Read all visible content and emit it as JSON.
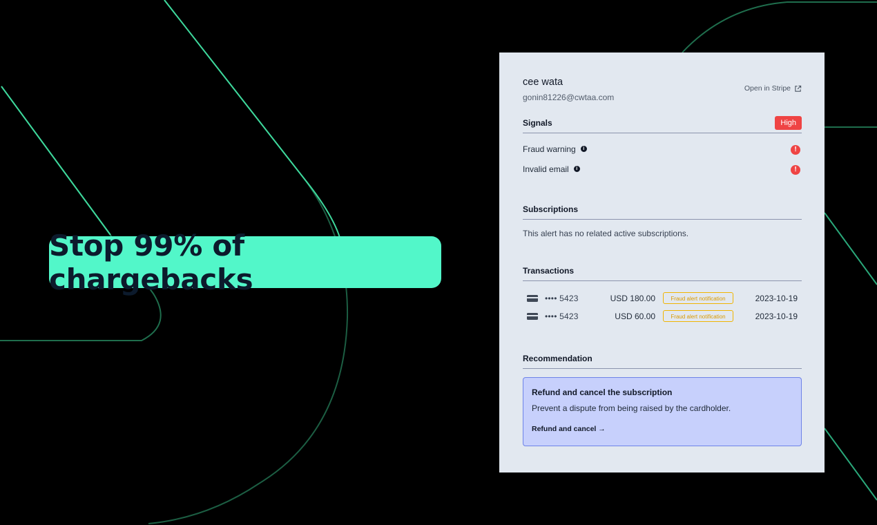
{
  "headline": "Stop 99% of chargebacks",
  "customer": {
    "name": "cee wata",
    "email": "gonin81226@cwtaa.com",
    "open_link": "Open in Stripe"
  },
  "signals": {
    "title": "Signals",
    "risk_badge": "High",
    "items": [
      {
        "label": "Fraud warning"
      },
      {
        "label": "Invalid email"
      }
    ]
  },
  "subscriptions": {
    "title": "Subscriptions",
    "empty_text": "This alert has no related active subscriptions."
  },
  "transactions": {
    "title": "Transactions",
    "rows": [
      {
        "card": "•••• 5423",
        "amount": "USD 180.00",
        "tag": "Fraud alert notification",
        "date": "2023-10-19"
      },
      {
        "card": "•••• 5423",
        "amount": "USD 60.00",
        "tag": "Fraud alert notification",
        "date": "2023-10-19"
      }
    ]
  },
  "recommendation": {
    "title": "Recommendation",
    "box_title": "Refund and cancel the subscription",
    "box_description": "Prevent a dispute from being raised by the cardholder.",
    "action_label": "Refund and cancel",
    "action_arrow": "→"
  },
  "colors": {
    "accent_mint": "#52f7c9",
    "danger": "#ef4444",
    "warning": "#f0b400",
    "reco_bg": "#c7d0fc"
  }
}
